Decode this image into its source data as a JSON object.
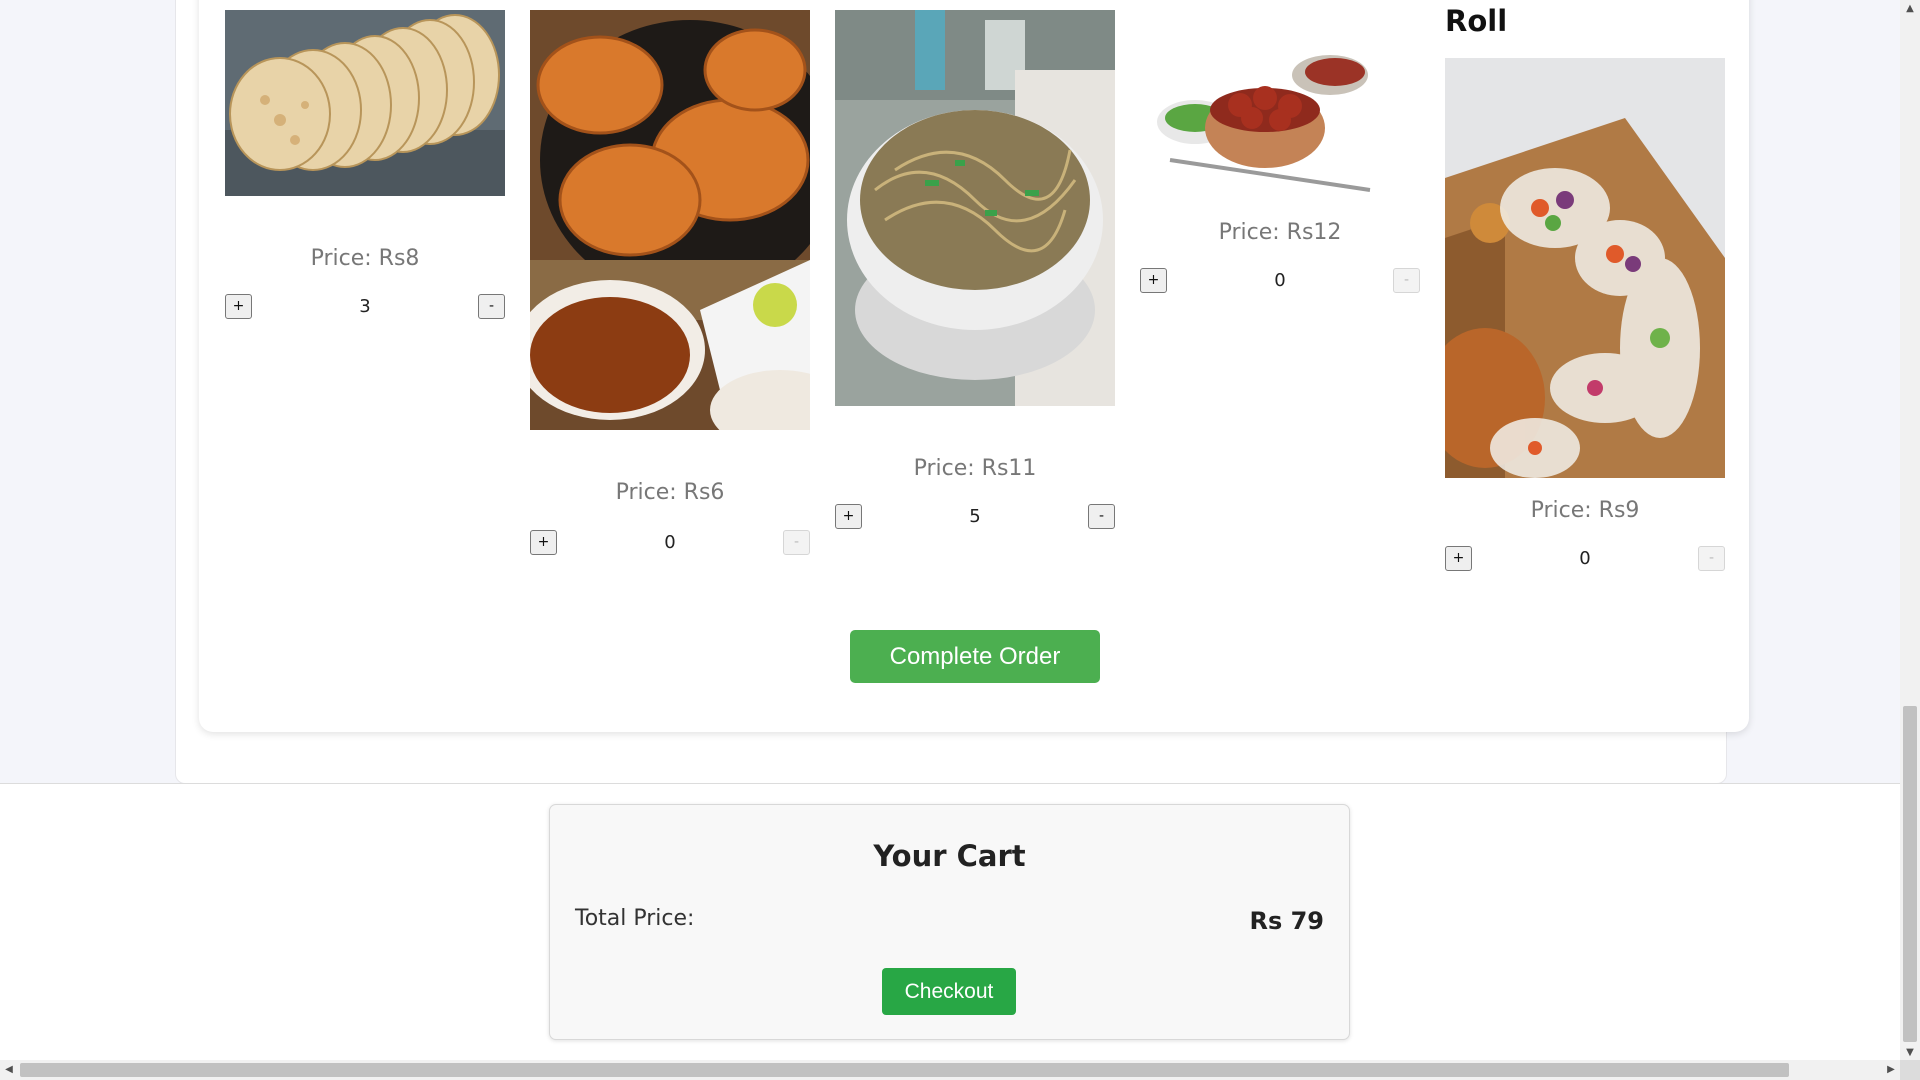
{
  "menu": {
    "items": [
      {
        "name": "",
        "image": "paratha-photo",
        "price": "Price: Rs8",
        "quantity": "3",
        "plus": "+",
        "minus": "-",
        "minus_disabled": false
      },
      {
        "name": "",
        "image": "cutlet-photo",
        "price": "Price: Rs6",
        "quantity": "0",
        "plus": "+",
        "minus": "-",
        "minus_disabled": true
      },
      {
        "name": "",
        "image": "noodles-photo",
        "price": "Price: Rs11",
        "quantity": "5",
        "plus": "+",
        "minus": "-",
        "minus_disabled": false
      },
      {
        "name": "",
        "image": "manchurian-photo",
        "price": "Price: Rs12",
        "quantity": "0",
        "plus": "+",
        "minus": "-",
        "minus_disabled": true
      },
      {
        "name": "Roll",
        "image": "spring-roll-photo",
        "price": "Price: Rs9",
        "quantity": "0",
        "plus": "+",
        "minus": "-",
        "minus_disabled": true
      }
    ],
    "complete_order_label": "Complete Order"
  },
  "cart": {
    "title": "Your Cart",
    "total_label": "Total Price:",
    "total_value": "Rs 79",
    "checkout_label": "Checkout"
  },
  "colors": {
    "page_bg": "#f4f5fa",
    "complete_button": "#4caf50",
    "checkout_button": "#28a745"
  }
}
